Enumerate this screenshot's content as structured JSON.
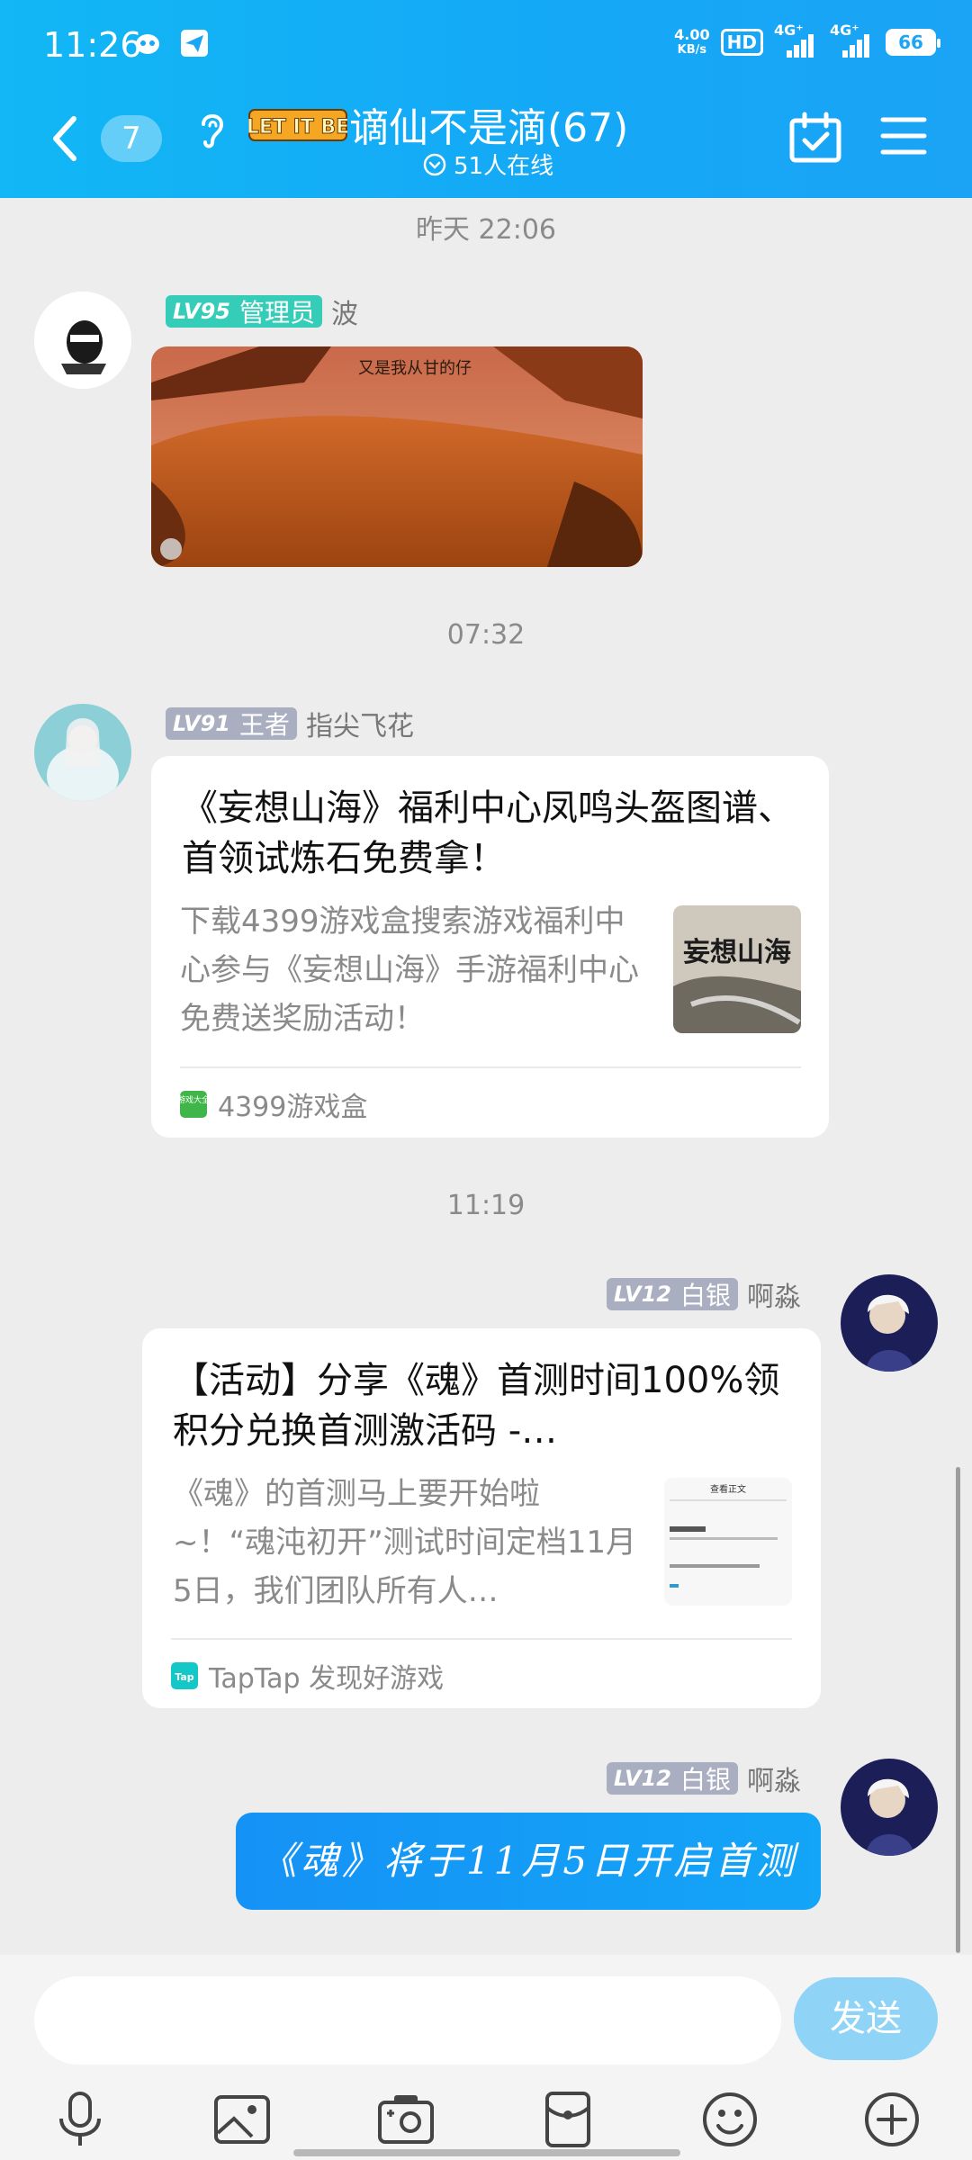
{
  "status_bar": {
    "time": "11:26",
    "network_speed": "4.00",
    "network_unit": "KB/s",
    "hd_label": "HD",
    "sim1_label": "4G⁺",
    "sim2_label": "4G⁺",
    "battery": "66"
  },
  "header": {
    "unread_badge": "7",
    "logo_text": "LET IT BE",
    "group_title": "谪仙不是滴(67)",
    "online_text": "51人在线"
  },
  "messages": {
    "stamp1": "昨天 22:06",
    "msg1": {
      "level": "LV95",
      "title": "管理员",
      "name": "波",
      "image_caption": "又是我从甘的仔"
    },
    "stamp2": "07:32",
    "msg2": {
      "level": "LV91",
      "title": "王者",
      "name": "指尖飞花",
      "card_title": "《妄想山海》福利中心凤鸣头盔图谱、首领试炼石免费拿！",
      "card_desc": "下载4399游戏盒搜索游戏福利中心参与《妄想山海》手游福利中心免费送奖励活动！",
      "thumb_text": "妄想山海",
      "source": "4399游戏盒",
      "source_icon_text": "游戏大全"
    },
    "stamp3": "11:19",
    "msg3": {
      "level": "LV12",
      "title": "白银",
      "name": "啊淼",
      "card_title": "【活动】分享《魂》首测时间100%领积分兑换首测激活码 -…",
      "card_desc": "《魂》的首测马上要开始啦~！“魂沌初开”测试时间定档11月5日，我们团队所有人…",
      "thumb_heading": "查看正文",
      "source": "TapTap 发现好游戏",
      "source_icon_text": "Tap"
    },
    "msg4": {
      "level": "LV12",
      "title": "白银",
      "name": "啊淼",
      "text": "《魂》将于11月5日开启首测"
    }
  },
  "input_bar": {
    "placeholder": "",
    "send_label": "发送"
  },
  "toolbar": [
    "microphone-icon",
    "image-icon",
    "camera-icon",
    "red-packet-icon",
    "emoji-icon",
    "plus-icon"
  ]
}
